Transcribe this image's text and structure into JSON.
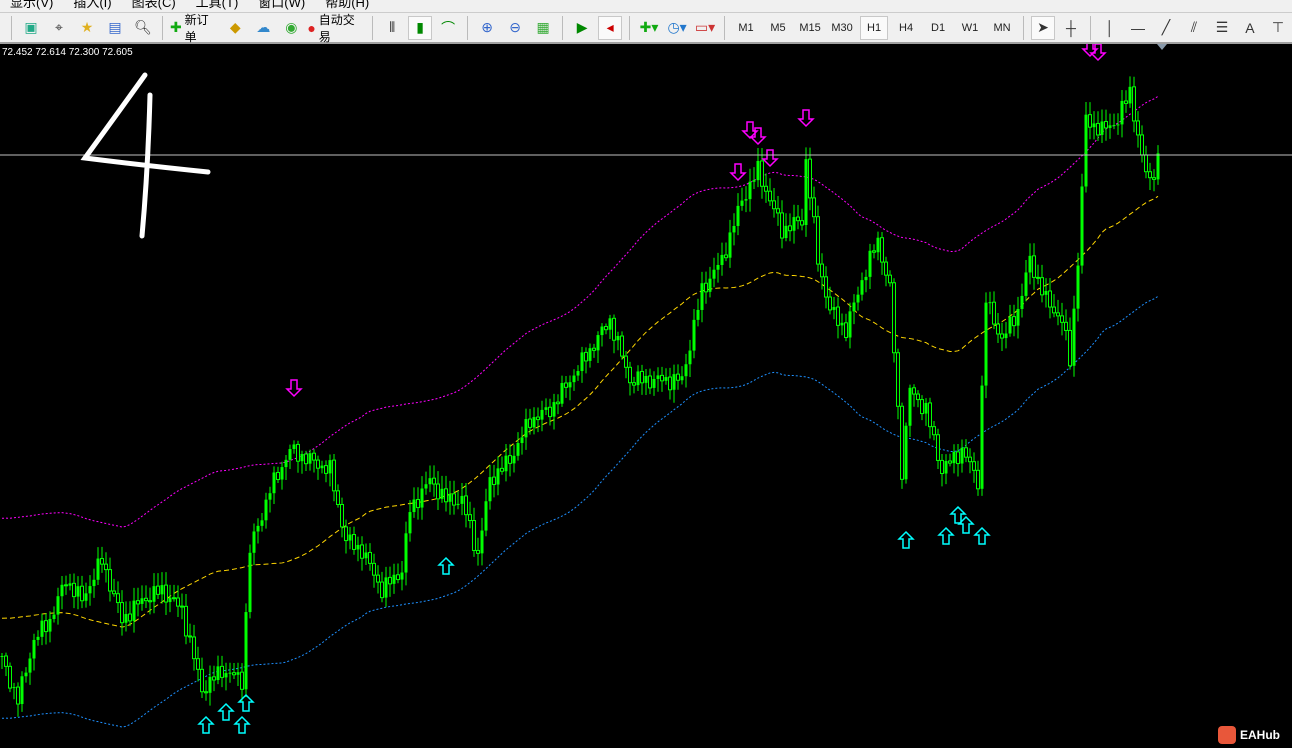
{
  "menu": [
    "显示(V)",
    "插入(I)",
    "图表(C)",
    "工具(T)",
    "窗口(W)",
    "帮助(H)"
  ],
  "toolbar": {
    "new_order": "新订单",
    "auto_trade": "自动交易",
    "timeframes": [
      "M1",
      "M5",
      "M15",
      "M30",
      "H1",
      "H4",
      "D1",
      "W1",
      "MN"
    ],
    "active_timeframe": "H1",
    "text_tool": "A"
  },
  "ohlc": "72.452 72.614 72.300 72.605",
  "logo": "EAHub",
  "annotation": "4",
  "colors": {
    "bull": "#00ff00",
    "ma": "#ffd700",
    "upper": "#ff00ff",
    "lower": "#1e90ff",
    "up_arrow": "#00ffff",
    "down_arrow": "#ff00ff"
  },
  "chart_data": {
    "type": "candlestick",
    "bid_line": 72.605,
    "band_offset": 0.2,
    "keyframes": [
      [
        0,
        71.595
      ],
      [
        4,
        71.515
      ],
      [
        8,
        71.635
      ],
      [
        12,
        71.675
      ],
      [
        16,
        71.755
      ],
      [
        20,
        71.715
      ],
      [
        25,
        71.795
      ],
      [
        30,
        71.675
      ],
      [
        35,
        71.715
      ],
      [
        40,
        71.735
      ],
      [
        45,
        71.695
      ],
      [
        50,
        71.535
      ],
      [
        55,
        71.575
      ],
      [
        60,
        71.555
      ],
      [
        62,
        71.815
      ],
      [
        67,
        71.935
      ],
      [
        72,
        72.015
      ],
      [
        77,
        71.995
      ],
      [
        82,
        71.975
      ],
      [
        86,
        71.835
      ],
      [
        90,
        71.815
      ],
      [
        95,
        71.735
      ],
      [
        100,
        71.775
      ],
      [
        102,
        71.895
      ],
      [
        107,
        71.955
      ],
      [
        111,
        71.915
      ],
      [
        115,
        71.915
      ],
      [
        119,
        71.805
      ],
      [
        122,
        71.955
      ],
      [
        127,
        71.995
      ],
      [
        132,
        72.075
      ],
      [
        137,
        72.095
      ],
      [
        142,
        72.155
      ],
      [
        147,
        72.215
      ],
      [
        152,
        72.275
      ],
      [
        157,
        72.155
      ],
      [
        162,
        72.155
      ],
      [
        170,
        72.155
      ],
      [
        175,
        72.335
      ],
      [
        180,
        72.395
      ],
      [
        185,
        72.515
      ],
      [
        189,
        72.575
      ],
      [
        192,
        72.515
      ],
      [
        195,
        72.455
      ],
      [
        200,
        72.475
      ],
      [
        201,
        72.595
      ],
      [
        204,
        72.395
      ],
      [
        207,
        72.295
      ],
      [
        211,
        72.255
      ],
      [
        215,
        72.355
      ],
      [
        219,
        72.435
      ],
      [
        222,
        72.335
      ],
      [
        225,
        71.975
      ],
      [
        227,
        72.135
      ],
      [
        231,
        72.095
      ],
      [
        235,
        71.975
      ],
      [
        240,
        72.015
      ],
      [
        244,
        71.955
      ],
      [
        246,
        72.315
      ],
      [
        250,
        72.235
      ],
      [
        254,
        72.295
      ],
      [
        257,
        72.395
      ],
      [
        261,
        72.315
      ],
      [
        265,
        72.275
      ],
      [
        267,
        72.195
      ],
      [
        269,
        72.395
      ],
      [
        271,
        72.675
      ],
      [
        275,
        72.655
      ],
      [
        279,
        72.675
      ],
      [
        282,
        72.735
      ],
      [
        285,
        72.595
      ],
      [
        287,
        72.555
      ],
      [
        289,
        72.595
      ]
    ],
    "up_arrows": [
      [
        51,
        71.465
      ],
      [
        56,
        71.491
      ],
      [
        60,
        71.465
      ],
      [
        61,
        71.509
      ],
      [
        111,
        71.783
      ],
      [
        226,
        71.835
      ],
      [
        236,
        71.843
      ],
      [
        239,
        71.885
      ],
      [
        241,
        71.865
      ],
      [
        245,
        71.843
      ]
    ],
    "down_arrows": [
      [
        73,
        72.139
      ],
      [
        184,
        72.571
      ],
      [
        187,
        72.655
      ],
      [
        189,
        72.643
      ],
      [
        192,
        72.599
      ],
      [
        201,
        72.679
      ],
      [
        272,
        72.819
      ],
      [
        274,
        72.811
      ]
    ]
  }
}
